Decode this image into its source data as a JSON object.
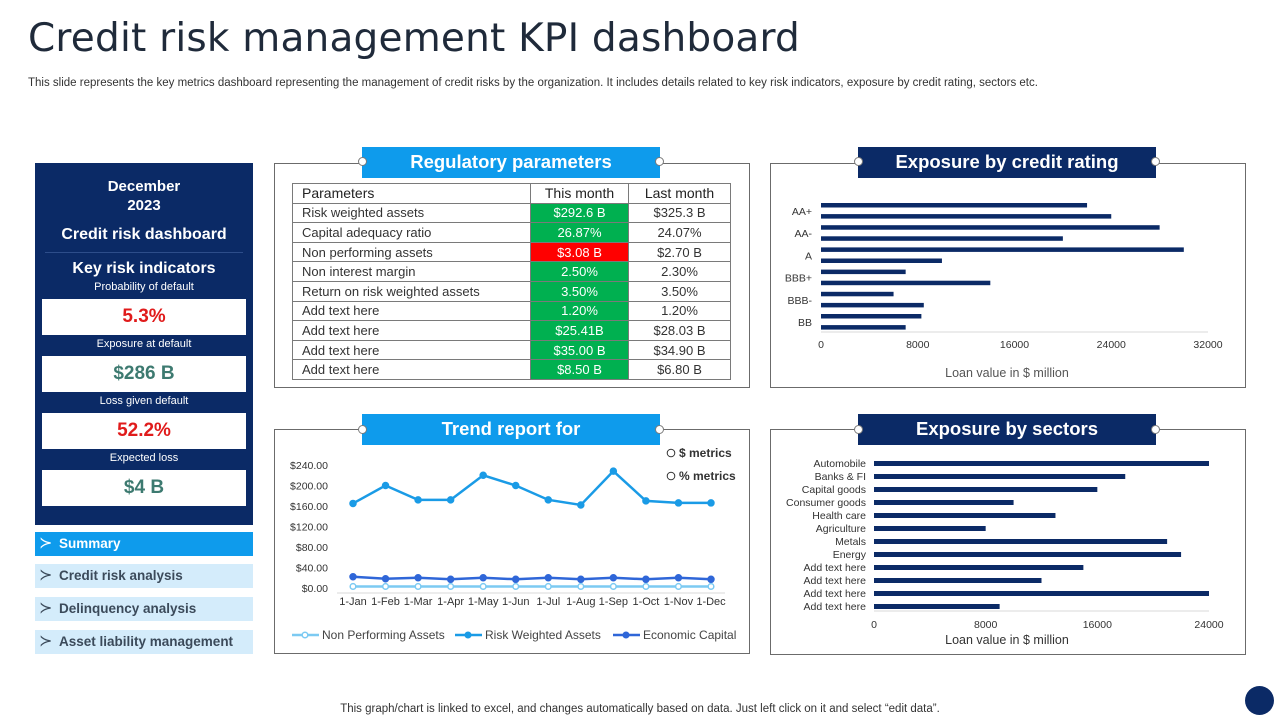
{
  "title": "Credit risk management KPI dashboard",
  "subtitle": "This slide represents the key metrics dashboard representing the management of credit risks by the organization. It includes details related to key risk indicators, exposure by credit rating, sectors etc.",
  "left_panel": {
    "month": "December",
    "year": "2023",
    "dashboard_name": "Credit risk dashboard",
    "section_title": "Key risk indicators",
    "kpis": [
      {
        "label": "Probability of default",
        "value": "5.3%"
      },
      {
        "label": "Exposure at default",
        "value": "$286 B"
      },
      {
        "label": "Loss given default",
        "value": "52.2%"
      },
      {
        "label": "Expected loss",
        "value": "$4 B"
      }
    ]
  },
  "nav": {
    "arrow": "≻",
    "items": [
      "Summary",
      "Credit risk analysis",
      "Delinquency analysis",
      "Asset  liability management"
    ]
  },
  "regulatory": {
    "title": "Regulatory parameters",
    "headers": [
      "Parameters",
      "This month",
      "Last month"
    ],
    "rows": [
      {
        "param": "Risk weighted assets",
        "this": "$292.6 B",
        "last": "$325.3 B",
        "status": "green"
      },
      {
        "param": "Capital adequacy ratio",
        "this": "26.87%",
        "last": "24.07%",
        "status": "green"
      },
      {
        "param": "Non performing  assets",
        "this": "$3.08 B",
        "last": "$2.70 B",
        "status": "red"
      },
      {
        "param": "Non interest margin",
        "this": "2.50%",
        "last": "2.30%",
        "status": "green"
      },
      {
        "param": "Return on risk weighted assets",
        "this": "3.50%",
        "last": "3.50%",
        "status": "green"
      },
      {
        "param": "Add text here",
        "this": "1.20%",
        "last": "1.20%",
        "status": "green"
      },
      {
        "param": "Add text here",
        "this": "$25.41B",
        "last": "$28.03 B",
        "status": "green"
      },
      {
        "param": "Add text here",
        "this": "$35.00 B",
        "last": "$34.90 B",
        "status": "green"
      },
      {
        "param": "Add text here",
        "this": "$8.50 B",
        "last": "$6.80 B",
        "status": "green"
      }
    ]
  },
  "colors": {
    "navy": "#0b2a66",
    "light_blue": "#0e9bec",
    "green": "#00b050",
    "red": "#ff0000",
    "bar": "#0b2a66",
    "npa_line": "#7ccaf2",
    "rwa_line": "#1a9be6",
    "ec_line": "#2f66d8"
  },
  "footer": "This graph/chart is linked to excel, and changes automatically based on data. Just left click on it and select “edit data”.",
  "chart_data": [
    {
      "type": "bar",
      "orientation": "horizontal",
      "title": "Exposure by credit rating",
      "xlabel": "Loan value  in $ million",
      "xlim": [
        0,
        32000
      ],
      "xticks": [
        0,
        8000,
        16000,
        24000,
        32000
      ],
      "categories": [
        "AA+",
        "",
        "AA-",
        "",
        "A",
        "",
        "BBB+",
        "",
        "BBB-",
        "",
        "BB"
      ],
      "bar_categories": [
        "AA+",
        "",
        "AA-",
        "",
        "A",
        "",
        "BBB+",
        "",
        "BBB-",
        "",
        "BB",
        ""
      ],
      "values": [
        22000,
        24000,
        28000,
        20000,
        30000,
        10000,
        7000,
        14000,
        6000,
        8500,
        8300,
        7000
      ]
    },
    {
      "type": "bar",
      "orientation": "horizontal",
      "title": "Exposure by sectors",
      "xlabel": "Loan value  in $ million",
      "xlim": [
        0,
        24000
      ],
      "xticks": [
        0,
        8000,
        16000,
        24000
      ],
      "categories": [
        "Automobile",
        "Banks & FI",
        "Capital goods",
        "Consumer goods",
        "Health care",
        "Agriculture",
        "Metals",
        "Energy",
        "Add text here",
        "Add text here",
        "Add text here",
        "Add text here"
      ],
      "values": [
        24000,
        18000,
        16000,
        10000,
        13000,
        8000,
        21000,
        22000,
        15000,
        12000,
        24000,
        9000
      ]
    },
    {
      "type": "line",
      "title": "Trend report for",
      "toggle_options": [
        "$ metrics",
        "% metrics"
      ],
      "ylim": [
        0,
        240
      ],
      "yticks": [
        "$0.00",
        "$40.00",
        "$80.00",
        "$120.00",
        "$160.00",
        "$200.00",
        "$240.00"
      ],
      "x": [
        "1-Jan",
        "1-Feb",
        "1-Mar",
        "1-Apr",
        "1-May",
        "1-Jun",
        "1-Jul",
        "1-Aug",
        "1-Sep",
        "1-Oct",
        "1-Nov",
        "1-Dec"
      ],
      "series": [
        {
          "name": "Non Performing Assets",
          "values": [
            3,
            3,
            3,
            3,
            3,
            3,
            3,
            3,
            3,
            3,
            3,
            3
          ]
        },
        {
          "name": "Risk Weighted Assets",
          "values": [
            165,
            200,
            172,
            172,
            220,
            200,
            172,
            162,
            228,
            170,
            166,
            166
          ]
        },
        {
          "name": "Economic Capital",
          "values": [
            22,
            18,
            20,
            17,
            20,
            17,
            20,
            17,
            20,
            17,
            20,
            17
          ]
        }
      ]
    }
  ]
}
